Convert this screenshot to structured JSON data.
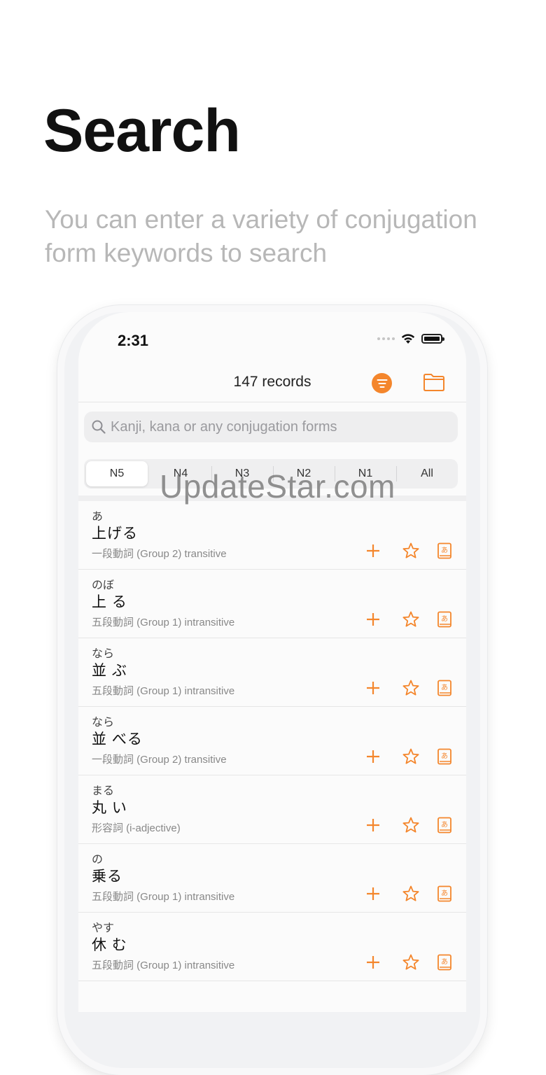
{
  "headline": "Search",
  "subtitle": "You can enter a variety of conjugation form keywords to search",
  "status": {
    "time": "2:31"
  },
  "nav": {
    "title": "147 records",
    "filter_icon": "filter-icon",
    "folder_icon": "folder-icon"
  },
  "search": {
    "placeholder": "Kanji, kana or any conjugation forms"
  },
  "levels": [
    "N5",
    "N4",
    "N3",
    "N2",
    "N1",
    "All"
  ],
  "selected_level": "N5",
  "watermark": "UpdateStar.com",
  "colors": {
    "accent": "#f4862c",
    "muted_text": "#888888",
    "subtitle": "#b7b7b7"
  },
  "entries": [
    {
      "furigana": "あ",
      "word": "上げる",
      "type": "一段動詞 (Group 2) transitive"
    },
    {
      "furigana": "のぼ",
      "word": "上 る",
      "type": "五段動詞 (Group 1) intransitive"
    },
    {
      "furigana": "なら",
      "word": "並 ぶ",
      "type": "五段動詞 (Group 1) intransitive"
    },
    {
      "furigana": "なら",
      "word": "並 べる",
      "type": "一段動詞 (Group 2) transitive"
    },
    {
      "furigana": "まる",
      "word": "丸 い",
      "type": "形容詞 (i-adjective)"
    },
    {
      "furigana": "の",
      "word": "乗る",
      "type": "五段動詞 (Group 1) intransitive"
    },
    {
      "furigana": "やす",
      "word": "休 む",
      "type": "五段動詞 (Group 1) intransitive"
    }
  ]
}
